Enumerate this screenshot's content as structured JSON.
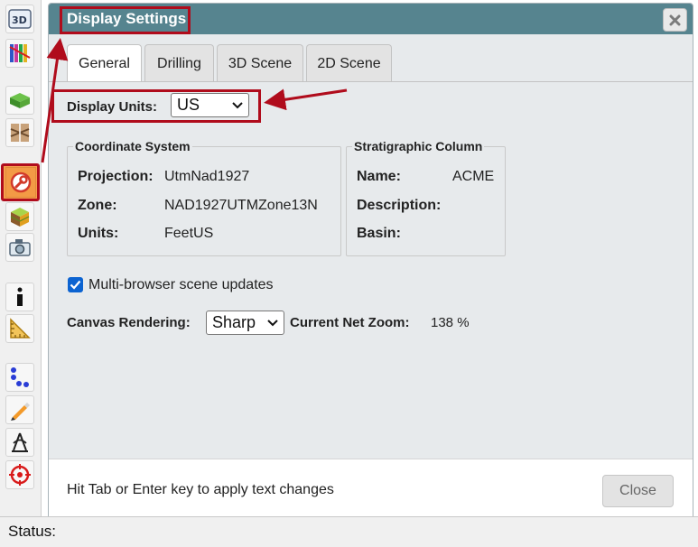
{
  "dialog": {
    "title": "Display Settings",
    "close_icon": "close-icon",
    "tabs": [
      {
        "label": "General",
        "active": true
      },
      {
        "label": "Drilling",
        "active": false
      },
      {
        "label": "3D Scene",
        "active": false
      },
      {
        "label": "2D Scene",
        "active": false
      }
    ],
    "display_units": {
      "label": "Display Units:",
      "value": "US"
    },
    "coordinate_system": {
      "legend": "Coordinate System",
      "rows": [
        {
          "key": "Projection:",
          "value": "UtmNad1927"
        },
        {
          "key": "Zone:",
          "value": "NAD1927UTMZone13N"
        },
        {
          "key": "Units:",
          "value": "FeetUS"
        }
      ]
    },
    "stratigraphic_column": {
      "legend": "Stratigraphic Column",
      "rows": [
        {
          "key": "Name:",
          "value": "ACME"
        },
        {
          "key": "Description:",
          "value": ""
        },
        {
          "key": "Basin:",
          "value": ""
        }
      ]
    },
    "multi_browser": {
      "label": "Multi-browser scene updates",
      "checked": true
    },
    "canvas_rendering": {
      "label": "Canvas Rendering:",
      "value": "Sharp"
    },
    "net_zoom": {
      "label": "Current Net Zoom:",
      "value": "138 %"
    },
    "footer_hint": "Hit Tab or Enter key to apply text changes",
    "close_button": "Close"
  },
  "toolbar": {
    "tools": [
      "3d-view-icon",
      "colored-bars-icon",
      "surfaces-icon",
      "cross-section-icon",
      "wrench-icon",
      "cube-icon",
      "camera-icon",
      "info-icon",
      "ruler-icon",
      "points-icon",
      "pencil-icon",
      "compass-icon",
      "target-icon"
    ],
    "active_tool": "wrench-icon"
  },
  "status": {
    "label": "Status:"
  },
  "colors": {
    "titlebar": "#56848f",
    "dialog_bg": "#e7eaec",
    "annotation": "#b00c1c",
    "active_tool": "#f6a04d",
    "checkbox": "#0b63d1"
  }
}
